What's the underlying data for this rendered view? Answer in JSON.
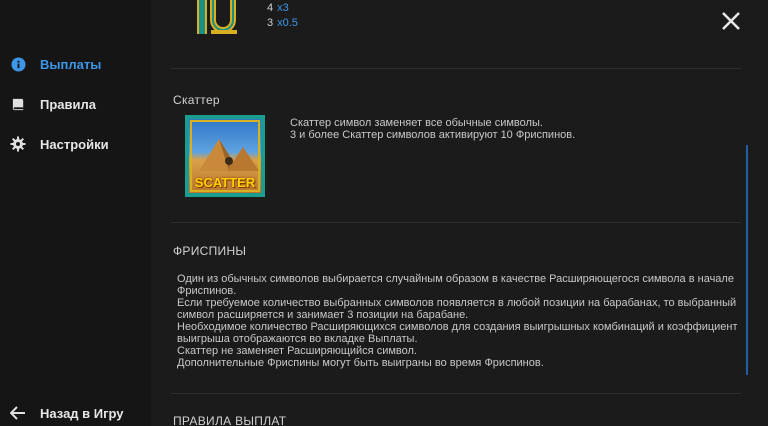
{
  "sidebar": {
    "items": [
      {
        "label": "Выплаты",
        "icon": "info-icon",
        "active": true
      },
      {
        "label": "Правила",
        "icon": "book-icon",
        "active": false
      },
      {
        "label": "Настройки",
        "icon": "gear-icon",
        "active": false
      }
    ],
    "back_label": "Назад в Игру"
  },
  "paytable": {
    "rows": [
      {
        "count": "4",
        "mult": "x3"
      },
      {
        "count": "3",
        "mult": "x0.5"
      }
    ]
  },
  "scatter": {
    "title": "Скаттер",
    "line1": "Скаттер символ заменяет все обычные символы.",
    "line2": "3 и более Скаттер символов активируют 10 Фриспинов.",
    "badge": "SCATTER"
  },
  "freespins": {
    "title": "ФРИСПИНЫ",
    "lines": [
      "Один из обычных символов выбирается случайным образом в качестве Расширяющегося символа в начале",
      "Фриспинов.",
      "Если требуемое количество выбранных символов появляется в любой позиции на барабанах, то выбранный",
      "символ расширяется и занимает 3 позиции на барабане.",
      "Необходимое количество Расширяющихся символов для создания выигрышных комбинаций и коэффициент",
      "выигрыша отображаются во вкладке Выплаты.",
      "Скаттер не заменяет Расширяющийся символ.",
      "Дополнительные Фриспины могут быть выиграны во время Фриспинов."
    ]
  },
  "payout_rules": {
    "title": "ПРАВИЛА ВЫПЛАТ"
  },
  "colors": {
    "accent": "#3d96e8",
    "background": "#1b1b1b",
    "sidebar": "#151515"
  }
}
